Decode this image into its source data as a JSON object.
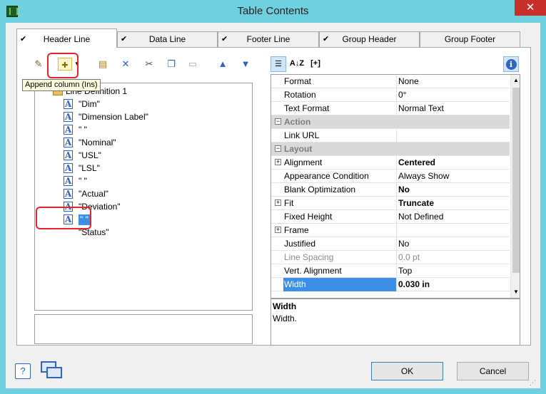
{
  "window": {
    "title": "Table Contents",
    "close_glyph": "✕"
  },
  "tabs": [
    {
      "label": "Header Line",
      "checked": true,
      "active": true
    },
    {
      "label": "Data Line",
      "checked": true,
      "active": false
    },
    {
      "label": "Footer Line",
      "checked": true,
      "active": false
    },
    {
      "label": "Group Header",
      "checked": true,
      "active": false
    },
    {
      "label": "Group Footer",
      "checked": false,
      "active": false
    }
  ],
  "tooltip": "Append column (Ins)",
  "tree": {
    "root_label": "Line Definition 1",
    "root_expander": "−",
    "items": [
      {
        "label": "\"Dim\""
      },
      {
        "label": "\"Dimension Label\""
      },
      {
        "label": "\" \""
      },
      {
        "label": "\"Nominal\""
      },
      {
        "label": "\"USL\""
      },
      {
        "label": "\"LSL\""
      },
      {
        "label": "\" \""
      },
      {
        "label": "\"Actual\""
      },
      {
        "label": "\"Deviation\""
      },
      {
        "label": "\" \""
      },
      {
        "label": "\"Status\""
      }
    ],
    "icon_letter": "A"
  },
  "props": [
    {
      "name": "Format",
      "value": "None"
    },
    {
      "name": "Rotation",
      "value": "0°"
    },
    {
      "name": "Text Format",
      "value": "Normal Text"
    },
    {
      "name": "Action",
      "category": true
    },
    {
      "name": "Link URL",
      "value": ""
    },
    {
      "name": "Layout",
      "category": true
    },
    {
      "name": "Alignment",
      "value": "Centered",
      "bold": true,
      "expandable": true
    },
    {
      "name": "Appearance Condition",
      "value": "Always Show"
    },
    {
      "name": "Blank Optimization",
      "value": "No",
      "bold": true
    },
    {
      "name": "Fit",
      "value": "Truncate",
      "bold": true,
      "expandable": true
    },
    {
      "name": "Fixed Height",
      "value": "Not Defined"
    },
    {
      "name": "Frame",
      "value": "",
      "expandable": true
    },
    {
      "name": "Justified",
      "value": "No"
    },
    {
      "name": "Line Spacing",
      "value": "0.0 pt",
      "disabled": true
    },
    {
      "name": "Vert. Alignment",
      "value": "Top"
    },
    {
      "name": "Width",
      "value": "0.030 in",
      "bold": true,
      "selected": true
    }
  ],
  "description": {
    "title": "Width",
    "text": "Width."
  },
  "toolbar_right": {
    "sort_label": "A↓Z",
    "expand_label": "[+]",
    "info_label": "i"
  },
  "buttons": {
    "ok": "OK",
    "cancel": "Cancel",
    "help": "?"
  }
}
